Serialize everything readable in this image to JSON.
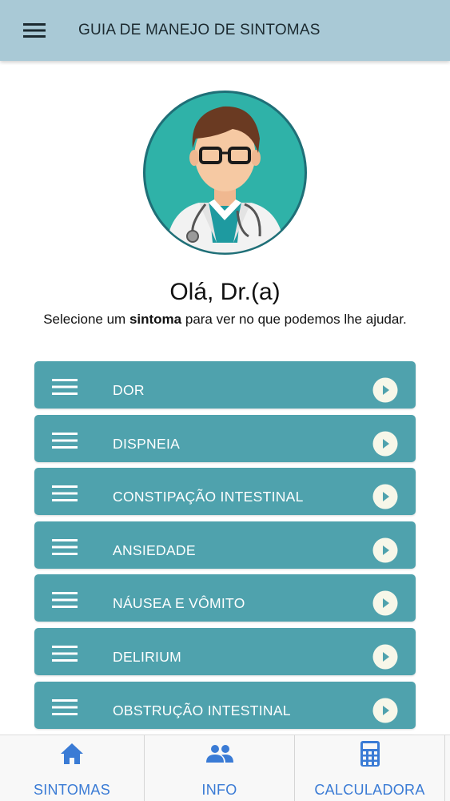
{
  "header": {
    "title": "GUIA DE MANEJO DE SINTOMAS",
    "menu_icon": "hamburger-menu-icon",
    "background_color": "#a9c9d6"
  },
  "hero": {
    "avatar_icon": "doctor-avatar-icon",
    "greeting": "Olá, Dr.(a)",
    "subtitle_before": "Selecione um ",
    "subtitle_bold": "sintoma",
    "subtitle_after": " para ver no que podemos lhe ajudar."
  },
  "symptoms": {
    "item_color": "#4fa2ad",
    "items": [
      {
        "label": "DOR"
      },
      {
        "label": "DISPNEIA"
      },
      {
        "label": "CONSTIPAÇÃO INTESTINAL"
      },
      {
        "label": "ANSIEDADE"
      },
      {
        "label": "NÁUSEA E VÔMITO"
      },
      {
        "label": "DELIRIUM"
      },
      {
        "label": "OBSTRUÇÃO INTESTINAL"
      }
    ]
  },
  "bottom_nav": {
    "accent_color": "#3a7bd5",
    "tabs": [
      {
        "label": "SINTOMAS",
        "icon": "home-icon"
      },
      {
        "label": "INFO",
        "icon": "people-icon"
      },
      {
        "label": "CALCULADORA",
        "icon": "calculator-icon"
      }
    ]
  }
}
